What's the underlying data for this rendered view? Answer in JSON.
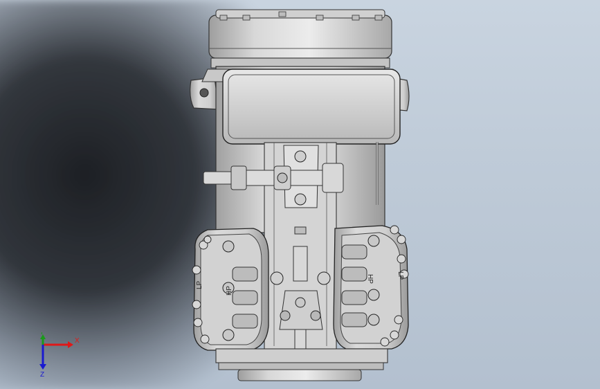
{
  "viewport": {
    "model_name": "compressor-assembly"
  },
  "engraved_text": {
    "left_lp": "LP",
    "left_hp": "HP",
    "right_hp": "HP",
    "right_lp": "LP"
  },
  "triad": {
    "x_label": "X",
    "y_label": "Y",
    "z_label": "Z",
    "x_color": "#e01818",
    "y_color": "#1a9a1a",
    "z_color": "#1a1ad0"
  }
}
